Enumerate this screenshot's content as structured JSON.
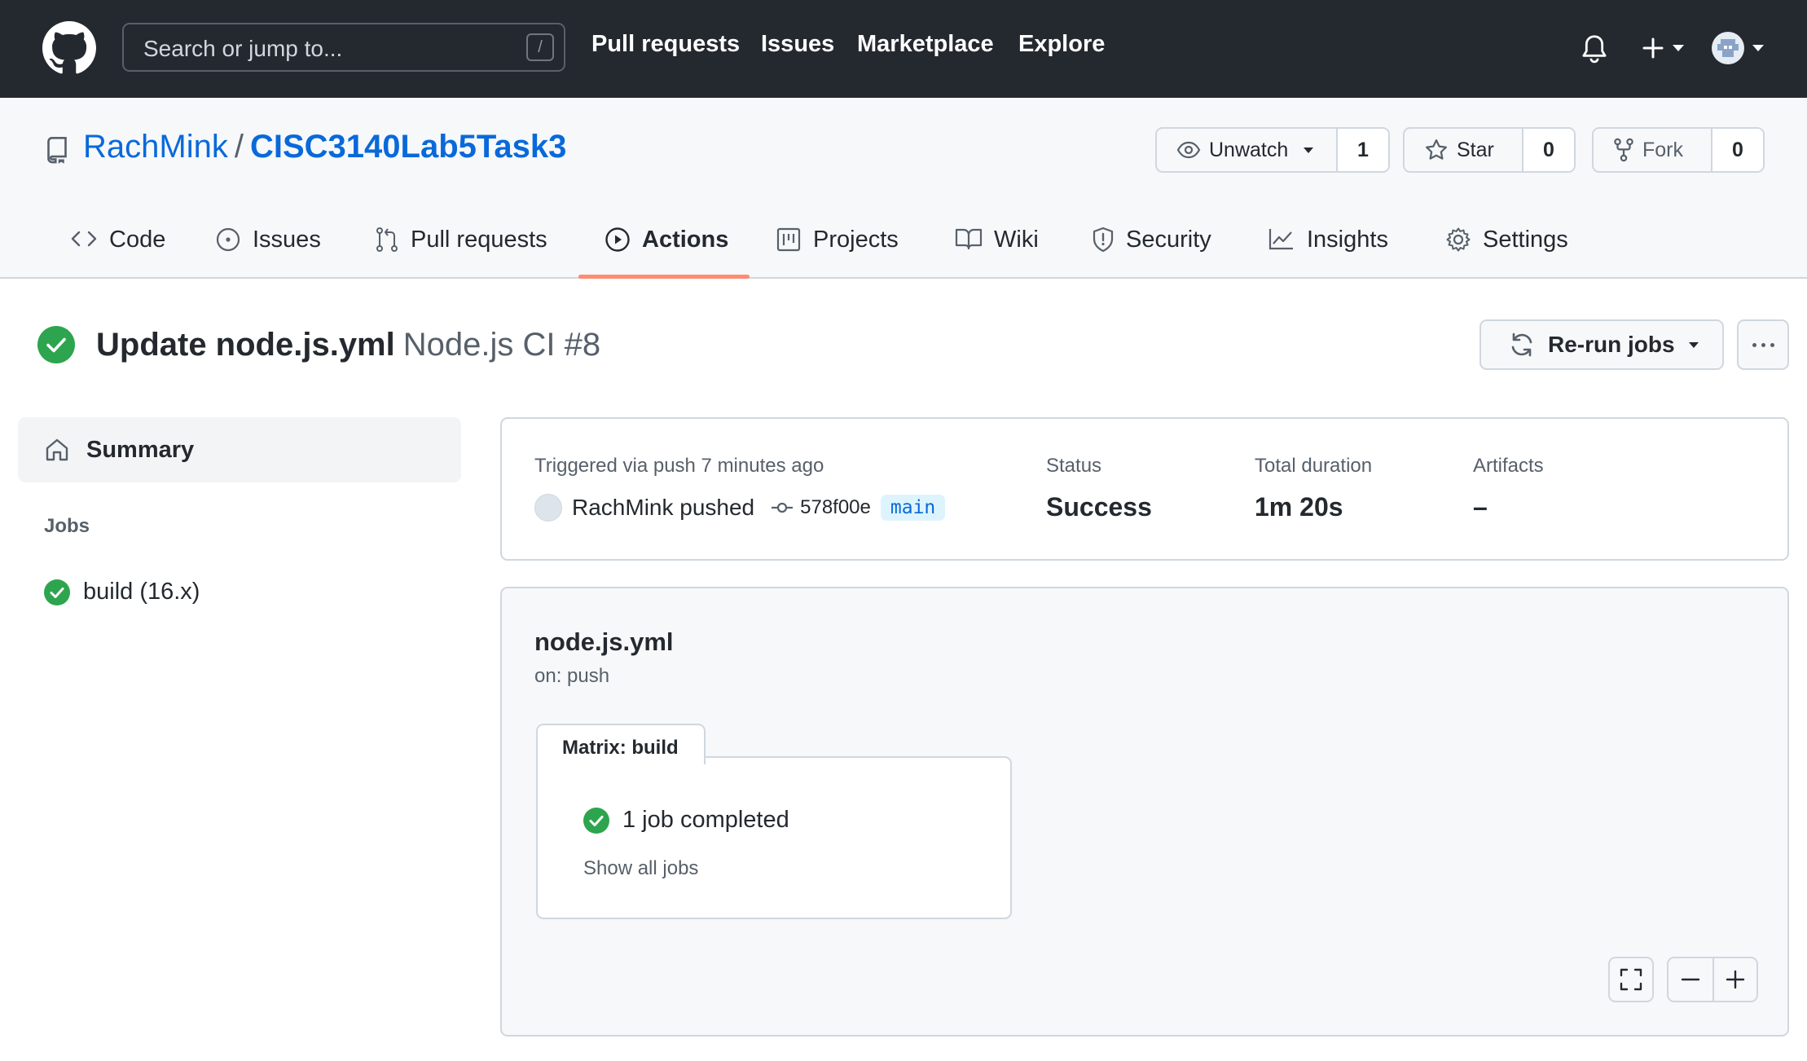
{
  "header": {
    "search_placeholder": "Search or jump to...",
    "search_shortcut": "/",
    "nav": [
      "Pull requests",
      "Issues",
      "Marketplace",
      "Explore"
    ]
  },
  "repo": {
    "owner": "RachMink",
    "separator": "/",
    "name": "CISC3140Lab5Task3",
    "watch": {
      "label": "Unwatch",
      "count": "1"
    },
    "star": {
      "label": "Star",
      "count": "0"
    },
    "fork": {
      "label": "Fork",
      "count": "0"
    }
  },
  "tabs": [
    {
      "label": "Code",
      "icon": "code-icon"
    },
    {
      "label": "Issues",
      "icon": "issue-icon"
    },
    {
      "label": "Pull requests",
      "icon": "pull-request-icon"
    },
    {
      "label": "Actions",
      "icon": "play-icon",
      "active": true
    },
    {
      "label": "Projects",
      "icon": "project-icon"
    },
    {
      "label": "Wiki",
      "icon": "book-icon"
    },
    {
      "label": "Security",
      "icon": "shield-icon"
    },
    {
      "label": "Insights",
      "icon": "graph-icon"
    },
    {
      "label": "Settings",
      "icon": "gear-icon"
    }
  ],
  "run": {
    "title": "Update node.js.yml",
    "workflow": "Node.js CI #8",
    "rerun_label": "Re-run jobs"
  },
  "sidebar": {
    "summary_label": "Summary",
    "jobs_label": "Jobs",
    "jobs": [
      {
        "label": "build (16.x)",
        "status": "success"
      }
    ]
  },
  "summary": {
    "trigger_text": "Triggered via push 7 minutes ago",
    "actor_text": "RachMink pushed",
    "commit_sha": "578f00e",
    "branch": "main",
    "status_label": "Status",
    "status_value": "Success",
    "duration_label": "Total duration",
    "duration_value": "1m 20s",
    "artifacts_label": "Artifacts",
    "artifacts_value": "–"
  },
  "workflow_graph": {
    "file": "node.js.yml",
    "trigger": "on: push",
    "matrix_label": "Matrix: build",
    "matrix_status": "1 job completed",
    "show_all_label": "Show all jobs"
  },
  "colors": {
    "header_bg": "#24292f",
    "link": "#0969da",
    "success": "#1a7f37",
    "active_tab_underline": "#fd8c73"
  }
}
